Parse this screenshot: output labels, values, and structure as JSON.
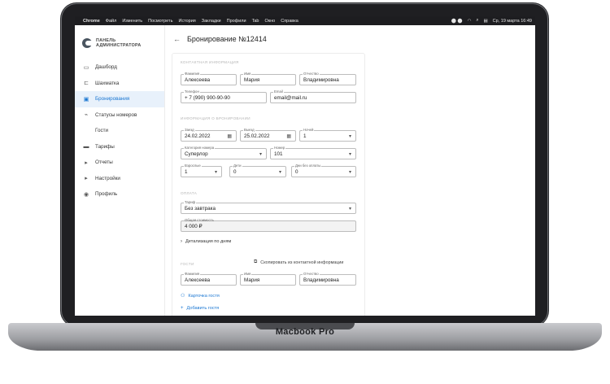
{
  "menubar": {
    "items": [
      "Chrome",
      "Файл",
      "Изменить",
      "Посмотреть",
      "История",
      "Закладки",
      "Профили",
      "Tab",
      "Окно",
      "Справка"
    ],
    "clock": "Ср, 19 марта 16:49"
  },
  "device_label": "Macbook Pro",
  "logo": {
    "line1": "ПАНЕЛЬ",
    "line2": "АДМИНИСТРАТОРА"
  },
  "sidebar": {
    "items": [
      {
        "label": "Дашборд",
        "icon": "monitor-icon"
      },
      {
        "label": "Шахматка",
        "icon": "bed-icon"
      },
      {
        "label": "Бронирования",
        "icon": "bookings-icon"
      },
      {
        "label": "Статусы номеров",
        "icon": "broom-icon"
      },
      {
        "label": "Гости",
        "icon": ""
      },
      {
        "label": "Тарифы",
        "icon": "card-icon"
      },
      {
        "label": "Отчеты",
        "icon": "chevron-right-icon"
      },
      {
        "label": "Настройки",
        "icon": "chevron-right-icon"
      },
      {
        "label": "Профиль",
        "icon": "user-circle-icon"
      }
    ],
    "active_index": 2
  },
  "page": {
    "title": "Бронирование №12414"
  },
  "contact": {
    "section_title": "КОНТАКТНАЯ ИНФОРМАЦИЯ",
    "last_name": {
      "label": "Фамилия",
      "value": "Алексеева"
    },
    "first_name": {
      "label": "Имя",
      "value": "Мария"
    },
    "patronymic": {
      "label": "Отчество",
      "value": "Владимировна"
    },
    "phone": {
      "label": "Телефон",
      "value": "+ 7 (990) 900-90-90"
    },
    "email": {
      "label": "Email",
      "value": "email@mail.ru"
    }
  },
  "booking": {
    "section_title": "ИНФОРМАЦИЯ О БРОНИРОВАНИИ",
    "checkin": {
      "label": "Заезд",
      "value": "24.02.2022"
    },
    "checkout": {
      "label": "Выезд",
      "value": "25.02.2022"
    },
    "nights": {
      "label": "Ночей",
      "value": "1"
    },
    "category": {
      "label": "Категория номера",
      "value": "Суперлор"
    },
    "room": {
      "label": "Номер",
      "value": "101"
    },
    "adults": {
      "label": "Взрослые",
      "value": "1"
    },
    "children": {
      "label": "Дети",
      "value": "0"
    },
    "unpaid_days": {
      "label": "Дни без оплаты",
      "value": "0"
    }
  },
  "payment": {
    "section_title": "ОПЛАТА",
    "tariff": {
      "label": "Тариф",
      "value": "Без завтрака"
    },
    "total": {
      "label": "Общая стоимость",
      "value": "4 000 ₽"
    },
    "details_link": "Детализация по дням"
  },
  "guests": {
    "section_title": "ГОСТИ",
    "copy_label": "Скопировать из контактной информации",
    "last_name": {
      "label": "Фамилия",
      "value": "Алексеева"
    },
    "first_name": {
      "label": "Имя",
      "value": "Мария"
    },
    "patronymic": {
      "label": "Отчество",
      "value": "Владимировна"
    },
    "card_link": "Карточка гостя",
    "add_link": "Добавить гостя"
  },
  "colors": {
    "accent": "#1976d2",
    "active_bg": "#e8f1fb"
  }
}
